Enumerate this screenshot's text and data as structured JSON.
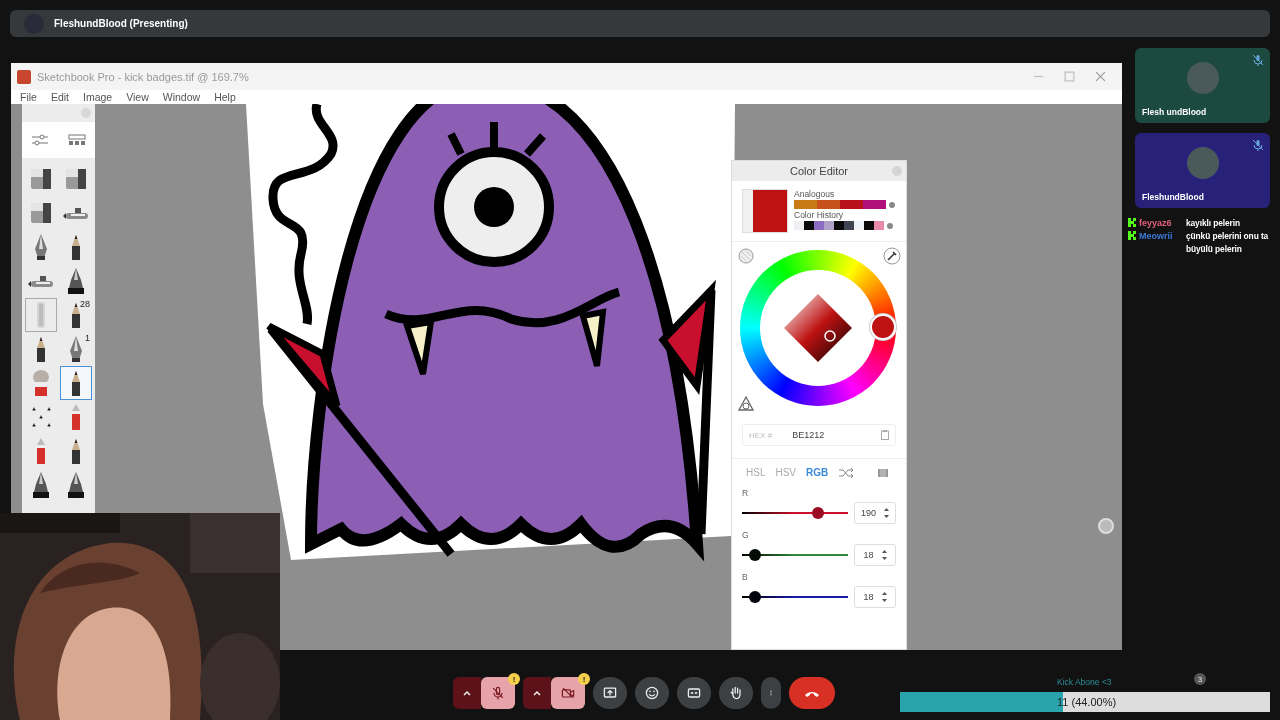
{
  "presenter_bar": {
    "name": "FleshundBlood (Presenting)"
  },
  "app_window": {
    "title": "Sketchbook Pro - kick badges.tif @ 169.7%",
    "menu": [
      "File",
      "Edit",
      "Image",
      "View",
      "Window",
      "Help"
    ]
  },
  "toolbox": {
    "tools": [
      {
        "kind": "block",
        "selected": false,
        "framed": false
      },
      {
        "kind": "block",
        "selected": false,
        "framed": false
      },
      {
        "kind": "block",
        "selected": false,
        "framed": false
      },
      {
        "kind": "airbrush",
        "selected": false,
        "framed": false
      },
      {
        "kind": "nib",
        "selected": false,
        "framed": false
      },
      {
        "kind": "pencil",
        "selected": false,
        "framed": false
      },
      {
        "kind": "airbrush",
        "selected": false,
        "framed": false
      },
      {
        "kind": "ink",
        "selected": false,
        "framed": false
      },
      {
        "kind": "smudge",
        "selected": false,
        "framed": true
      },
      {
        "kind": "pencil",
        "selected": false,
        "framed": false,
        "badge": "28"
      },
      {
        "kind": "pencil",
        "selected": false,
        "framed": false
      },
      {
        "kind": "nib",
        "selected": false,
        "framed": false,
        "badge": "1"
      },
      {
        "kind": "brush",
        "selected": false,
        "framed": false
      },
      {
        "kind": "pencil",
        "selected": true,
        "framed": false
      },
      {
        "kind": "pattern",
        "selected": false,
        "framed": false
      },
      {
        "kind": "marker",
        "selected": false,
        "framed": false
      },
      {
        "kind": "marker",
        "selected": false,
        "framed": false
      },
      {
        "kind": "pencil",
        "selected": false,
        "framed": false
      },
      {
        "kind": "ink",
        "selected": false,
        "framed": false
      },
      {
        "kind": "ink",
        "selected": false,
        "framed": false
      }
    ]
  },
  "color_editor": {
    "title": "Color Editor",
    "swatch": {
      "color": "#be1212"
    },
    "analogous": {
      "label": "Analogous",
      "colors": [
        {
          "color": "#c87a14"
        },
        {
          "color": "#c8501a"
        },
        {
          "color": "#b8101c"
        },
        {
          "color": "#b0107a"
        }
      ]
    },
    "history": {
      "label": "Color History",
      "colors": [
        {
          "color": "#f0eef2"
        },
        {
          "color": "#0a0a0a"
        },
        {
          "color": "#8a6cc0"
        },
        {
          "color": "#b0a0c8"
        },
        {
          "color": "#0a0a0a"
        },
        {
          "color": "#404450"
        },
        {
          "color": "#eef4f8"
        },
        {
          "color": "#0a0a0a"
        },
        {
          "color": "#e88aa8"
        }
      ]
    },
    "hex": {
      "label": "HEX #",
      "value": "BE1212"
    },
    "modes": [
      {
        "label": "HSL",
        "selected": false
      },
      {
        "label": "HSV",
        "selected": false
      },
      {
        "label": "RGB",
        "selected": true
      }
    ],
    "sliders": [
      {
        "label": "R",
        "value": "190",
        "level": 0.745,
        "color": "#d0102a"
      },
      {
        "label": "G",
        "value": "18",
        "level": 0.07,
        "color": "#2f8a3a"
      },
      {
        "label": "B",
        "value": "18",
        "level": 0.07,
        "color": "#1a1aa8"
      }
    ]
  },
  "participants": [
    {
      "name": "Flesh undBlood",
      "muted": true,
      "color": "#1d4a40"
    },
    {
      "name": "FleshundBlood",
      "muted": true,
      "color": "#27217a"
    }
  ],
  "chat": [
    {
      "user": "feyyaz6",
      "color": "#e0607a",
      "lines": [
        "kayıklı pelerin"
      ]
    },
    {
      "user": "Meowrii",
      "color": "#3a78d8",
      "lines": [
        "çünkü pelerini onu ta",
        "büyülü pelerin"
      ]
    }
  ],
  "call_controls": [
    {
      "kind": "mic",
      "off": true,
      "alert": "!"
    },
    {
      "kind": "camera",
      "off": true,
      "alert": "!"
    },
    {
      "kind": "present"
    },
    {
      "kind": "emoji"
    },
    {
      "kind": "captions"
    },
    {
      "kind": "hand"
    },
    {
      "kind": "more"
    },
    {
      "kind": "hangup"
    }
  ],
  "poll": {
    "label": "Kick Abone <3",
    "reading": "11 (44.00%)",
    "level": 0.44
  },
  "people_badge": "3"
}
